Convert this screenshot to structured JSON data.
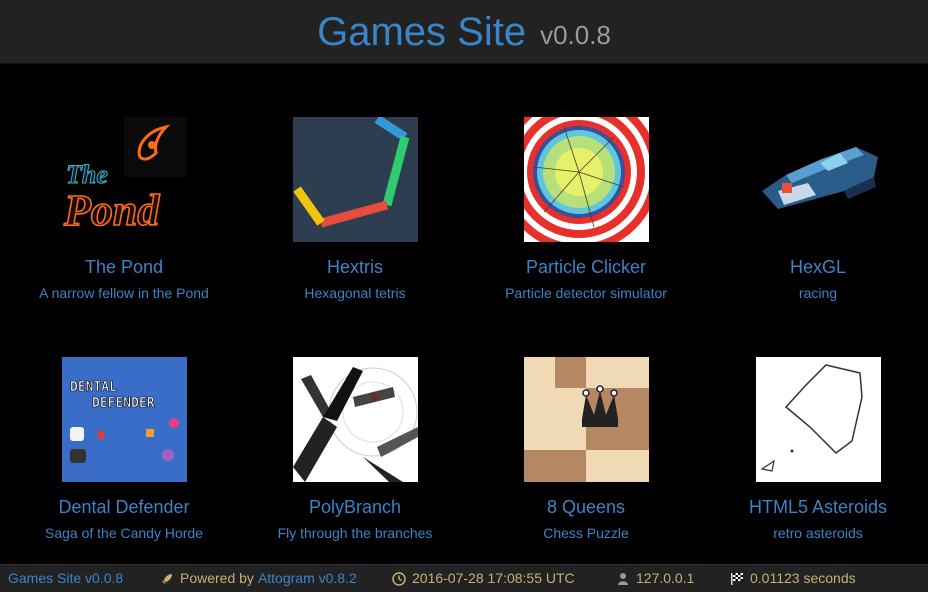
{
  "header": {
    "title": "Games Site",
    "version": "v0.0.8"
  },
  "games": [
    {
      "name": "The Pond",
      "desc": "A narrow fellow in the Pond",
      "thumb": "the-pond-thumbnail"
    },
    {
      "name": "Hextris",
      "desc": "Hexagonal tetris",
      "thumb": "hextris-thumbnail"
    },
    {
      "name": "Particle Clicker",
      "desc": "Particle detector simulator",
      "thumb": "particle-clicker-thumbnail"
    },
    {
      "name": "HexGL",
      "desc": "racing",
      "thumb": "hexgl-thumbnail"
    },
    {
      "name": "Dental Defender",
      "desc": "Saga of the Candy Horde",
      "thumb": "dental-defender-thumbnail"
    },
    {
      "name": "PolyBranch",
      "desc": "Fly through the branches",
      "thumb": "polybranch-thumbnail"
    },
    {
      "name": "8 Queens",
      "desc": "Chess Puzzle",
      "thumb": "8-queens-thumbnail"
    },
    {
      "name": "HTML5 Asteroids",
      "desc": "retro asteroids",
      "thumb": "html5-asteroids-thumbnail"
    }
  ],
  "thumb_text": {
    "pond_line1": "The",
    "pond_line2": "Pond",
    "dental_line1": "DENTAL",
    "dental_line2": "DEFENDER"
  },
  "footer": {
    "site_link": "Games Site v0.0.8",
    "powered_label": "Powered by ",
    "powered_link": "Attogram v0.8.2",
    "datetime": "2016-07-28 17:08:55 UTC",
    "ip": "127.0.0.1",
    "timing": "0.01123 seconds"
  },
  "colors": {
    "accent": "#3a84c8",
    "footer_text": "#c8b06e",
    "bar_bg": "#222222",
    "page_bg": "#000000"
  },
  "icons": {
    "powered": "rocket-icon",
    "datetime": "clock-icon",
    "ip": "user-icon",
    "timing": "checkered-flag-icon"
  }
}
